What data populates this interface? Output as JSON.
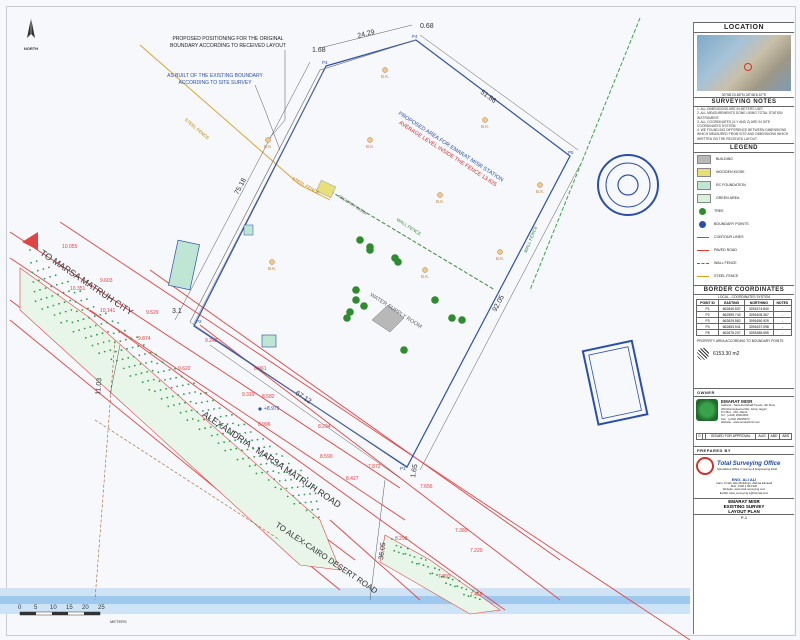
{
  "north_label": "NORTH",
  "annotations": {
    "proposed_positioning": [
      "PROPOSED POSITIONING FOR THE ORIGINAL",
      "BOUNDARY ACCORDING TO RECEIVED LAYOUT"
    ],
    "as_built": [
      "AS BUILT OF THE EXISTING BOUNDARY",
      "ACCORDING TO SITE SURVEY"
    ],
    "proposed_area": [
      "PROPOSED AREA FOR EMARAT MISR STATION",
      "AVERAGE LEVEL INSIDE THE FENCE 13.625"
    ],
    "water_supply_room": "WATER SUPPLY ROOM",
    "security_kiosk": "SECURITY KIOSK",
    "wall_fence_1": "WALL FENCE",
    "wall_fence_2": "WALL FENCE",
    "steel_fence_1": "STEEL FENCE",
    "steel_fence_2": "STEEL FENCE",
    "road_marsa": "TO MARSA MATRUH CITY",
    "road_alex_marsa": "ALEXANDRIA - MARSA MATRUH ROAD",
    "road_alex_cairo": "TO ALEX-CAIRO DESERT ROAD"
  },
  "dimensions": [
    "1.68",
    "24.29",
    "0.68",
    "51.86",
    "75.18",
    "3.1",
    "67.12",
    "92.05",
    "1.65",
    "36.05",
    "11.03"
  ],
  "points": [
    "P1",
    "P2",
    "P3",
    "P4",
    "P5"
  ],
  "spot_levels": [
    "10.055",
    "9.603",
    "10.351",
    "10.141",
    "9.529",
    "9.874",
    "9.242",
    "9.622",
    "8.961",
    "9.319",
    "8.582",
    "8.996",
    "8.294",
    "8.590",
    "8.427",
    "7.872",
    "7.656",
    "7.389",
    "7.220",
    "8.298",
    "7.893",
    "7.458"
  ],
  "bench_mark": "+8.979",
  "bk_label": "B.K.",
  "scale": {
    "ticks": [
      "0",
      "5",
      "10",
      "15",
      "20",
      "25"
    ],
    "unit": "METERS"
  },
  "panel": {
    "location_title": "LOCATION",
    "location_coords": "30°58'23.85\"N  28°48'6.57\"E",
    "surveying_notes_title": "SURVEYING NOTES",
    "notes": [
      "1. ALL DIMENSIONS ARE IN METERS UNIT.",
      "2. ALL MEASUREMENTS DONE USING TOTAL STATION INSTRUMENT.",
      "3. ALL COORDINATES (X,Y AND Z) ARE IN SITE COORDINATES SYSTEM.",
      "4. WE FOUND BIG DIFFERENCE BETWEEN DIMENSIONS WHICH MEASURED FROM SITE AND DIMENSIONS WHICH WRITTEN ON THE RECEIVED LAYOUT."
    ],
    "legend_title": "LEGEND",
    "legend": [
      {
        "label": "BUILDING",
        "color": "#b8b8b8"
      },
      {
        "label": "WOODEN KIOSK",
        "color": "#e6e07a"
      },
      {
        "label": "RC FOUNDATION",
        "color": "#bfe6d4"
      },
      {
        "label": "GREEN AREA",
        "color": "#d9f0dc"
      },
      {
        "label": "TREE",
        "color": "#2e8b2e"
      },
      {
        "label": "BOUNDARY POINTS",
        "color": "#2b4fa8"
      },
      {
        "label": "CONTOUR LINES",
        "color": "#a05a2c"
      },
      {
        "label": "PAVED ROAD",
        "color": "#d83a3a"
      },
      {
        "label": "WALL FENCE",
        "color": "#3a8a3a"
      },
      {
        "label": "STEEL FENCE",
        "color": "#d9a020"
      }
    ],
    "border_title": "BORDER COORDINATES",
    "coord_system": "LOCAL - COORDINATES SYSTEM",
    "coord_headers": [
      "POINT ID",
      "EASTING",
      "NORTHING",
      "NOTES"
    ],
    "coords": [
      [
        "P1",
        "662640.537",
        "3091574.840",
        "-"
      ],
      [
        "P2",
        "662599.740",
        "3091605.367",
        "-"
      ],
      [
        "P3",
        "662629.582",
        "3091650.929",
        "-"
      ],
      [
        "P4",
        "662653.941",
        "3091637.098",
        "-"
      ],
      [
        "P5",
        "662675.207",
        "3091585.595",
        "-"
      ]
    ],
    "area_label": "PROPERTY AREA ACCORDING TO BOUNDARY POINTS",
    "area_value": "6153.30 m2",
    "owner_title": "OWNER",
    "owner_name": "EMARAT MISR",
    "owner_address": [
      "Address : Tanta El Mahalli Tjoo2o, 4th Floor,",
      "330 Abd-Geleenta Nile, Gizon, Egypt",
      "P.O Box : 281, Mandi",
      "Tel : (+202) 25204460",
      "Fax : (+202) 25205970",
      "Website : www.emaratmisr.com"
    ],
    "issued_row": [
      "0",
      "",
      "ISSUED FOR APPROVAL",
      "AUG",
      "ABD",
      "ABS"
    ],
    "prepared_title": "PREPARED BY",
    "firm_name": "Total Surveying Office",
    "firm_tagline": "Specialized Office in Survey & Engineering Field",
    "firm_person": "ENG. ALI ALI",
    "firm_address": [
      "Cairo: 6 Nab. Eles Buildings, Zahraa Elmaadi",
      "Mob: 0106 4 923 920",
      "Website: www.total-surveying.com",
      "E-Mail: total_surveying.1@hotmail.com"
    ],
    "project": "EMARAT MISR",
    "drawing": "EXISTING SURVEY",
    "drawing_sub": "LAYOUT PLAN",
    "sheet_code": "P-1"
  }
}
